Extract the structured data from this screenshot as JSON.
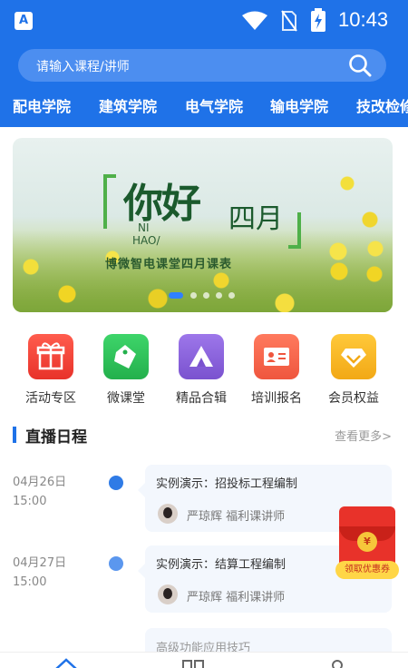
{
  "status_bar": {
    "app_icon": "A",
    "time": "10:43",
    "icons": [
      "wifi-icon",
      "no-sim-icon",
      "battery-charging-icon"
    ]
  },
  "search": {
    "placeholder": "请输入课程/讲师",
    "icon": "search-icon"
  },
  "nav": {
    "items": [
      {
        "label": "配电学院"
      },
      {
        "label": "建筑学院"
      },
      {
        "label": "电气学院"
      },
      {
        "label": "输电学院"
      },
      {
        "label": "技改检修"
      }
    ]
  },
  "banner": {
    "headline": "你好",
    "month": "四月",
    "english_1": "NI",
    "english_2": "HAO/",
    "subtitle": "博微智电课堂四月课表",
    "page_count": 5,
    "active_page": 1
  },
  "quick_menu": [
    {
      "label": "活动专区",
      "icon": "gift-icon",
      "color": "#f0453b"
    },
    {
      "label": "微课堂",
      "icon": "tags-icon",
      "color": "#2fc25c"
    },
    {
      "label": "精品合辑",
      "icon": "tent-icon",
      "color": "#8b63d8"
    },
    {
      "label": "培训报名",
      "icon": "id-card-icon",
      "color": "#f4664c"
    },
    {
      "label": "会员权益",
      "icon": "diamond-icon",
      "color": "#f5b51e"
    }
  ],
  "schedule": {
    "title": "直播日程",
    "more_label": "查看更多>",
    "items": [
      {
        "date": "04月26日",
        "time": "15:00",
        "title": "实例演示：招投标工程编制",
        "lecturer": "严琼辉 福利课讲师"
      },
      {
        "date": "04月27日",
        "time": "15:00",
        "title": "实例演示：结算工程编制",
        "lecturer": "严琼辉 福利课讲师"
      },
      {
        "date": "",
        "time": "",
        "title": "高级功能应用技巧",
        "lecturer": ""
      }
    ]
  },
  "floating_promo": {
    "coin_text": "¥",
    "button_label": "领取优惠券"
  },
  "colors": {
    "primary": "#1f72e8",
    "search_bg": "#4c8ef0",
    "card_bg": "#f3f7fd"
  },
  "tab_bar": {
    "icons": [
      "home-icon",
      "category-icon",
      "profile-icon"
    ]
  }
}
